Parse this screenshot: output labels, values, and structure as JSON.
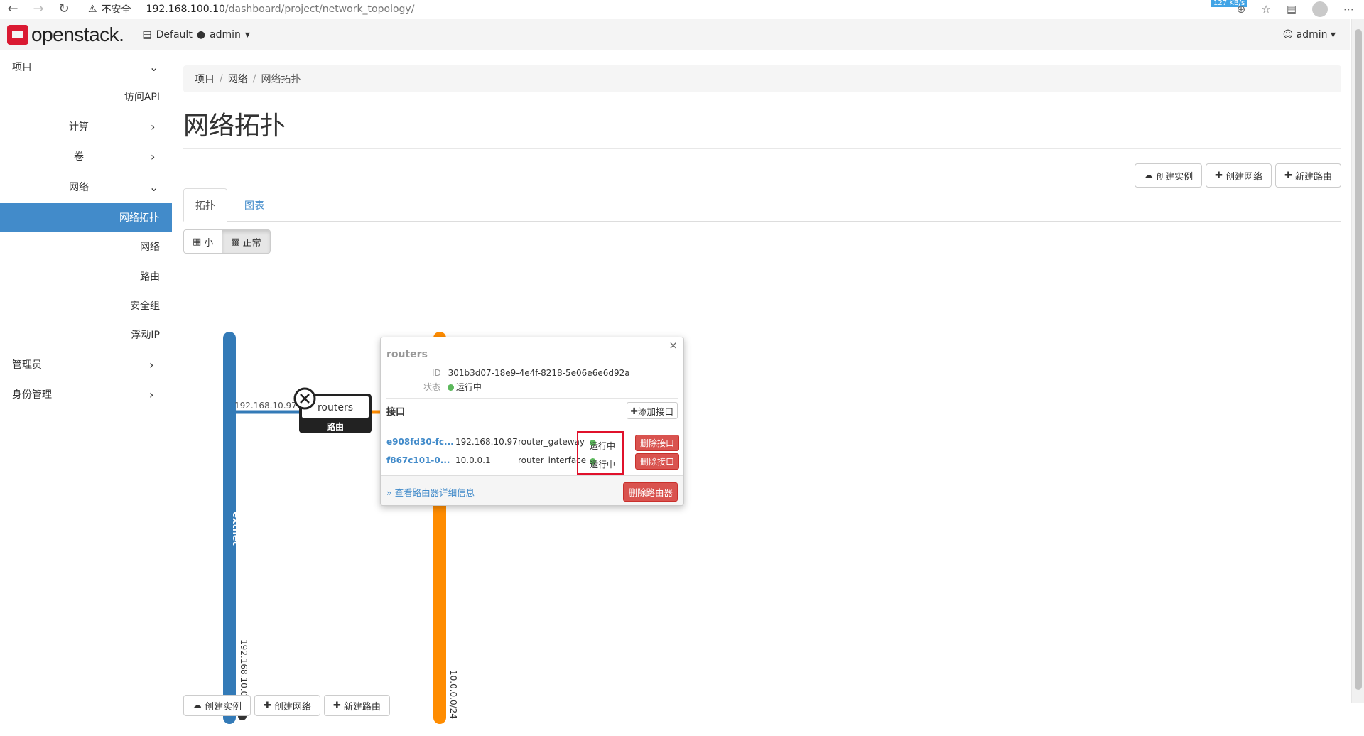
{
  "browser": {
    "security_label": "不安全",
    "url_host": "192.168.100.10",
    "url_path": "/dashboard/project/network_topology/",
    "speed": "127 KB/s"
  },
  "header": {
    "logo_text": "openstack.",
    "domain": "Default",
    "project": "admin",
    "user": "admin"
  },
  "sidebar": {
    "project": "项目",
    "api_access": "访问API",
    "compute": "计算",
    "volumes": "卷",
    "network": "网络",
    "network_topology": "网络拓扑",
    "networks": "网络",
    "routers": "路由",
    "security_groups": "安全组",
    "floating_ips": "浮动IP",
    "admin": "管理员",
    "identity": "身份管理"
  },
  "breadcrumb": [
    "项目",
    "网络",
    "网络拓扑"
  ],
  "page_title": "网络拓扑",
  "actions": {
    "create_instance": "创建实例",
    "create_network": "创建网络",
    "create_router": "新建路由"
  },
  "tabs": {
    "topology": "拓扑",
    "graph": "图表"
  },
  "view_toggle": {
    "small": "小",
    "normal": "正常"
  },
  "topology": {
    "ext_network": {
      "name": "extnet",
      "cidr": "192.168.10.0/24",
      "color": "#337ab7"
    },
    "int_network": {
      "cidr": "10.0.0.0/24",
      "color": "#ff8c00"
    },
    "router": {
      "name": "routers",
      "type_label": "路由",
      "gateway_ip": "192.168.10.97"
    }
  },
  "popup": {
    "title": "routers",
    "id_label": "ID",
    "id": "301b3d07-18e9-4e4f-8218-5e06e6e6d92a",
    "status_label": "状态",
    "status": "运行中",
    "ports_title": "接口",
    "add_port": "添加接口",
    "ports": [
      {
        "id": "e908fd30-fc...",
        "ip": "192.168.10.97",
        "owner": "router_gateway",
        "status": "运行中",
        "delete": "删除接口"
      },
      {
        "id": "f867c101-0...",
        "ip": "10.0.0.1",
        "owner": "router_interface",
        "status": "运行中",
        "delete": "删除接口"
      }
    ],
    "more": "» 查看路由器详细信息",
    "delete_router": "删除路由器"
  }
}
